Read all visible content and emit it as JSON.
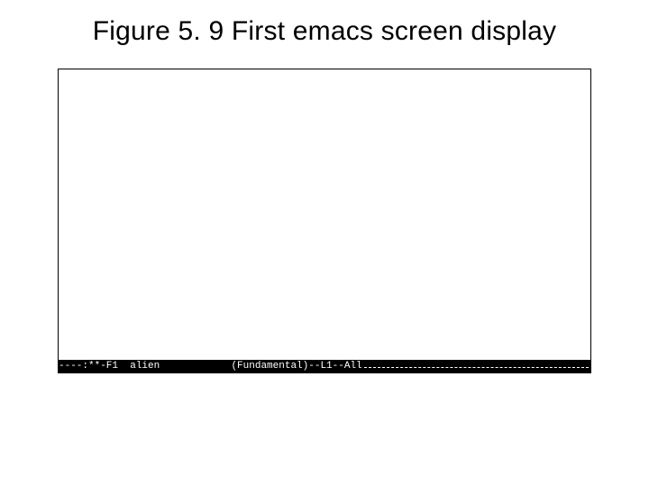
{
  "figure": {
    "caption": "Figure 5. 9  First emacs screen display"
  },
  "emacs": {
    "modeline": {
      "left": "----:**-F1  alien",
      "mode": "(Fundamental)--L1--All"
    }
  }
}
